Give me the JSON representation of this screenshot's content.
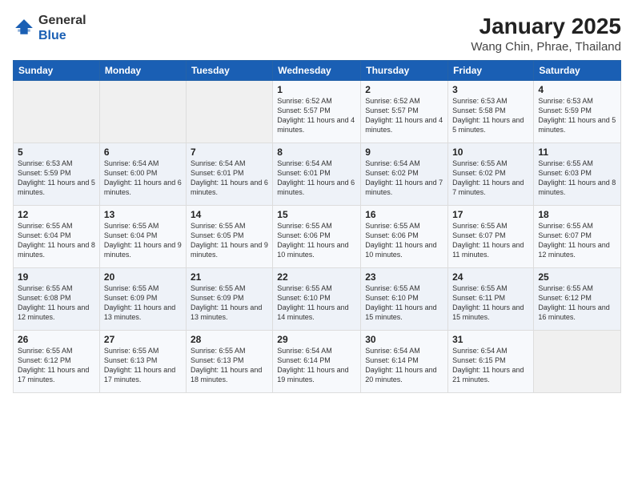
{
  "logo": {
    "general": "General",
    "blue": "Blue"
  },
  "title": "January 2025",
  "subtitle": "Wang Chin, Phrae, Thailand",
  "days_of_week": [
    "Sunday",
    "Monday",
    "Tuesday",
    "Wednesday",
    "Thursday",
    "Friday",
    "Saturday"
  ],
  "weeks": [
    [
      {
        "day": "",
        "sunrise": "",
        "sunset": "",
        "daylight": ""
      },
      {
        "day": "",
        "sunrise": "",
        "sunset": "",
        "daylight": ""
      },
      {
        "day": "",
        "sunrise": "",
        "sunset": "",
        "daylight": ""
      },
      {
        "day": "1",
        "sunrise": "Sunrise: 6:52 AM",
        "sunset": "Sunset: 5:57 PM",
        "daylight": "Daylight: 11 hours and 4 minutes."
      },
      {
        "day": "2",
        "sunrise": "Sunrise: 6:52 AM",
        "sunset": "Sunset: 5:57 PM",
        "daylight": "Daylight: 11 hours and 4 minutes."
      },
      {
        "day": "3",
        "sunrise": "Sunrise: 6:53 AM",
        "sunset": "Sunset: 5:58 PM",
        "daylight": "Daylight: 11 hours and 5 minutes."
      },
      {
        "day": "4",
        "sunrise": "Sunrise: 6:53 AM",
        "sunset": "Sunset: 5:59 PM",
        "daylight": "Daylight: 11 hours and 5 minutes."
      }
    ],
    [
      {
        "day": "5",
        "sunrise": "Sunrise: 6:53 AM",
        "sunset": "Sunset: 5:59 PM",
        "daylight": "Daylight: 11 hours and 5 minutes."
      },
      {
        "day": "6",
        "sunrise": "Sunrise: 6:54 AM",
        "sunset": "Sunset: 6:00 PM",
        "daylight": "Daylight: 11 hours and 6 minutes."
      },
      {
        "day": "7",
        "sunrise": "Sunrise: 6:54 AM",
        "sunset": "Sunset: 6:01 PM",
        "daylight": "Daylight: 11 hours and 6 minutes."
      },
      {
        "day": "8",
        "sunrise": "Sunrise: 6:54 AM",
        "sunset": "Sunset: 6:01 PM",
        "daylight": "Daylight: 11 hours and 6 minutes."
      },
      {
        "day": "9",
        "sunrise": "Sunrise: 6:54 AM",
        "sunset": "Sunset: 6:02 PM",
        "daylight": "Daylight: 11 hours and 7 minutes."
      },
      {
        "day": "10",
        "sunrise": "Sunrise: 6:55 AM",
        "sunset": "Sunset: 6:02 PM",
        "daylight": "Daylight: 11 hours and 7 minutes."
      },
      {
        "day": "11",
        "sunrise": "Sunrise: 6:55 AM",
        "sunset": "Sunset: 6:03 PM",
        "daylight": "Daylight: 11 hours and 8 minutes."
      }
    ],
    [
      {
        "day": "12",
        "sunrise": "Sunrise: 6:55 AM",
        "sunset": "Sunset: 6:04 PM",
        "daylight": "Daylight: 11 hours and 8 minutes."
      },
      {
        "day": "13",
        "sunrise": "Sunrise: 6:55 AM",
        "sunset": "Sunset: 6:04 PM",
        "daylight": "Daylight: 11 hours and 9 minutes."
      },
      {
        "day": "14",
        "sunrise": "Sunrise: 6:55 AM",
        "sunset": "Sunset: 6:05 PM",
        "daylight": "Daylight: 11 hours and 9 minutes."
      },
      {
        "day": "15",
        "sunrise": "Sunrise: 6:55 AM",
        "sunset": "Sunset: 6:06 PM",
        "daylight": "Daylight: 11 hours and 10 minutes."
      },
      {
        "day": "16",
        "sunrise": "Sunrise: 6:55 AM",
        "sunset": "Sunset: 6:06 PM",
        "daylight": "Daylight: 11 hours and 10 minutes."
      },
      {
        "day": "17",
        "sunrise": "Sunrise: 6:55 AM",
        "sunset": "Sunset: 6:07 PM",
        "daylight": "Daylight: 11 hours and 11 minutes."
      },
      {
        "day": "18",
        "sunrise": "Sunrise: 6:55 AM",
        "sunset": "Sunset: 6:07 PM",
        "daylight": "Daylight: 11 hours and 12 minutes."
      }
    ],
    [
      {
        "day": "19",
        "sunrise": "Sunrise: 6:55 AM",
        "sunset": "Sunset: 6:08 PM",
        "daylight": "Daylight: 11 hours and 12 minutes."
      },
      {
        "day": "20",
        "sunrise": "Sunrise: 6:55 AM",
        "sunset": "Sunset: 6:09 PM",
        "daylight": "Daylight: 11 hours and 13 minutes."
      },
      {
        "day": "21",
        "sunrise": "Sunrise: 6:55 AM",
        "sunset": "Sunset: 6:09 PM",
        "daylight": "Daylight: 11 hours and 13 minutes."
      },
      {
        "day": "22",
        "sunrise": "Sunrise: 6:55 AM",
        "sunset": "Sunset: 6:10 PM",
        "daylight": "Daylight: 11 hours and 14 minutes."
      },
      {
        "day": "23",
        "sunrise": "Sunrise: 6:55 AM",
        "sunset": "Sunset: 6:10 PM",
        "daylight": "Daylight: 11 hours and 15 minutes."
      },
      {
        "day": "24",
        "sunrise": "Sunrise: 6:55 AM",
        "sunset": "Sunset: 6:11 PM",
        "daylight": "Daylight: 11 hours and 15 minutes."
      },
      {
        "day": "25",
        "sunrise": "Sunrise: 6:55 AM",
        "sunset": "Sunset: 6:12 PM",
        "daylight": "Daylight: 11 hours and 16 minutes."
      }
    ],
    [
      {
        "day": "26",
        "sunrise": "Sunrise: 6:55 AM",
        "sunset": "Sunset: 6:12 PM",
        "daylight": "Daylight: 11 hours and 17 minutes."
      },
      {
        "day": "27",
        "sunrise": "Sunrise: 6:55 AM",
        "sunset": "Sunset: 6:13 PM",
        "daylight": "Daylight: 11 hours and 17 minutes."
      },
      {
        "day": "28",
        "sunrise": "Sunrise: 6:55 AM",
        "sunset": "Sunset: 6:13 PM",
        "daylight": "Daylight: 11 hours and 18 minutes."
      },
      {
        "day": "29",
        "sunrise": "Sunrise: 6:54 AM",
        "sunset": "Sunset: 6:14 PM",
        "daylight": "Daylight: 11 hours and 19 minutes."
      },
      {
        "day": "30",
        "sunrise": "Sunrise: 6:54 AM",
        "sunset": "Sunset: 6:14 PM",
        "daylight": "Daylight: 11 hours and 20 minutes."
      },
      {
        "day": "31",
        "sunrise": "Sunrise: 6:54 AM",
        "sunset": "Sunset: 6:15 PM",
        "daylight": "Daylight: 11 hours and 21 minutes."
      },
      {
        "day": "",
        "sunrise": "",
        "sunset": "",
        "daylight": ""
      }
    ]
  ]
}
